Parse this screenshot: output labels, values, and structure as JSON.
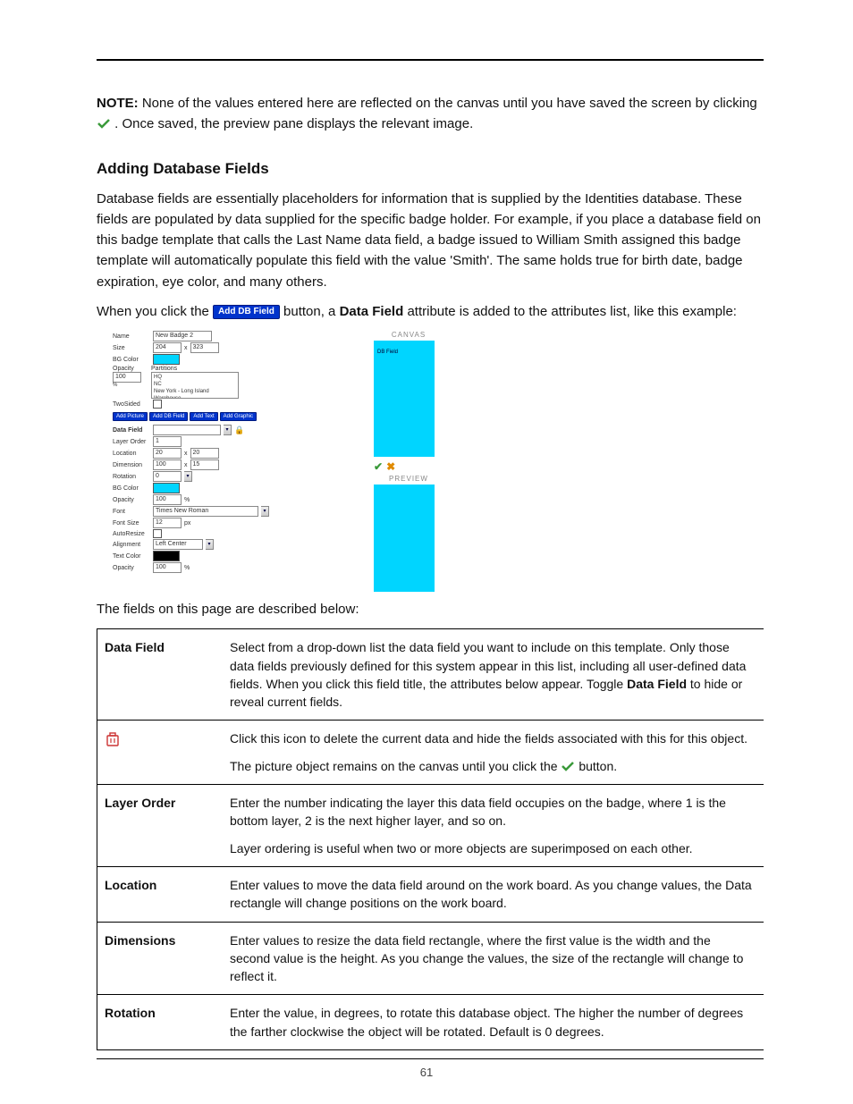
{
  "note": {
    "label": "NOTE:",
    "before_icon": "None of the values entered here are reflected on the canvas until you have saved the screen by clicking ",
    "after_icon": ". Once saved, the preview pane displays the relevant image."
  },
  "heading": "Adding Database Fields",
  "para1": "Database fields are essentially placeholders for information that is supplied by the Identities database. These fields are populated by data supplied for the specific badge holder. For example, if you place a database field on this badge template that calls the Last Name data field, a badge issued to William Smith assigned this badge template will automatically populate this field with the value 'Smith'. The same holds true for birth date, badge expiration, eye color, and many others.",
  "para2_before": "When you click the ",
  "add_db_btn": "Add DB Field",
  "para2_mid": " button, a ",
  "para2_bold": "Data Field",
  "para2_after": " attribute is added to the attributes list, like this example:",
  "ss": {
    "name_label": "Name",
    "name_value": "New Badge 2",
    "size_label": "Size",
    "size_w": "204",
    "size_x": "x",
    "size_h": "323",
    "bgcolor_label": "BG Color",
    "opacity_label": "Opacity",
    "opacity_value": "100",
    "opacity_pct": "%",
    "partitions_label": "Partitions",
    "part1": "HQ",
    "part2": "NC",
    "part3": "New York - Long Island Warehouse",
    "twosided_label": "TwoSided",
    "btn_picture": "Add Picture",
    "btn_dbfield": "Add DB Field",
    "btn_text": "Add Text",
    "btn_graphic": "Add Graphic",
    "datafield_label": "Data Field",
    "layerorder_label": "Layer Order",
    "layerorder_value": "1",
    "location_label": "Location",
    "loc_x": "20",
    "loc_y": "20",
    "dimension_label": "Dimension",
    "dim_w": "100",
    "dim_h": "15",
    "rotation_label": "Rotation",
    "rotation_value": "0",
    "bgcolor2_label": "BG Color",
    "opacity2_value": "100",
    "font_label": "Font",
    "font_value": "Times New Roman",
    "fontsize_label": "Font Size",
    "fontsize_value": "12",
    "autoresize_label": "AutoResize",
    "alignment_label": "Alignment",
    "alignment_value": "Left Center",
    "textcolor_label": "Text Color",
    "textcolor_value": "#000000",
    "opacity3_value": "100",
    "canvas_title": "CANVAS",
    "dbfield_tag": "DB Field",
    "preview_title": "PREVIEW"
  },
  "fields_intro": "The fields on this page are described below:",
  "rows": {
    "datafield": {
      "name": "Data Field",
      "d1a": "Select from a drop-down list the data field you want to include on this template. Only those data fields previously defined for this system appear in this list, including all user-defined data fields. When you click this field title, the attributes below appear. Toggle ",
      "d1b": "Data Field",
      "d1c": " to hide or reveal current fields."
    },
    "deleteicon": {
      "d1": "Click this icon to delete the current data and hide the fields associated with this for this object.",
      "d2a": "The picture object remains on the canvas until you click the ",
      "d2b": " button."
    },
    "layerorder": {
      "name": "Layer Order",
      "d1": "Enter the number indicating the layer this data field occupies on the badge, where 1 is the bottom layer, 2 is the next higher layer, and so on.",
      "d2": "Layer ordering is useful when two or more objects are superimposed on each other."
    },
    "location": {
      "name": "Location",
      "d1": "Enter values to move the data field around on the work board. As you change values, the Data rectangle will change positions on the work board."
    },
    "dimensions": {
      "name": "Dimensions",
      "d1": "Enter values to resize the data field rectangle, where the first value is the width and the second value is the height. As you change the values, the size of the rectangle will change to reflect it."
    },
    "rotation": {
      "name": "Rotation",
      "d1": "Enter the value, in degrees, to rotate this database object. The higher the number of degrees the farther clockwise the object will be rotated. Default is 0 degrees."
    }
  },
  "page_number": "61"
}
